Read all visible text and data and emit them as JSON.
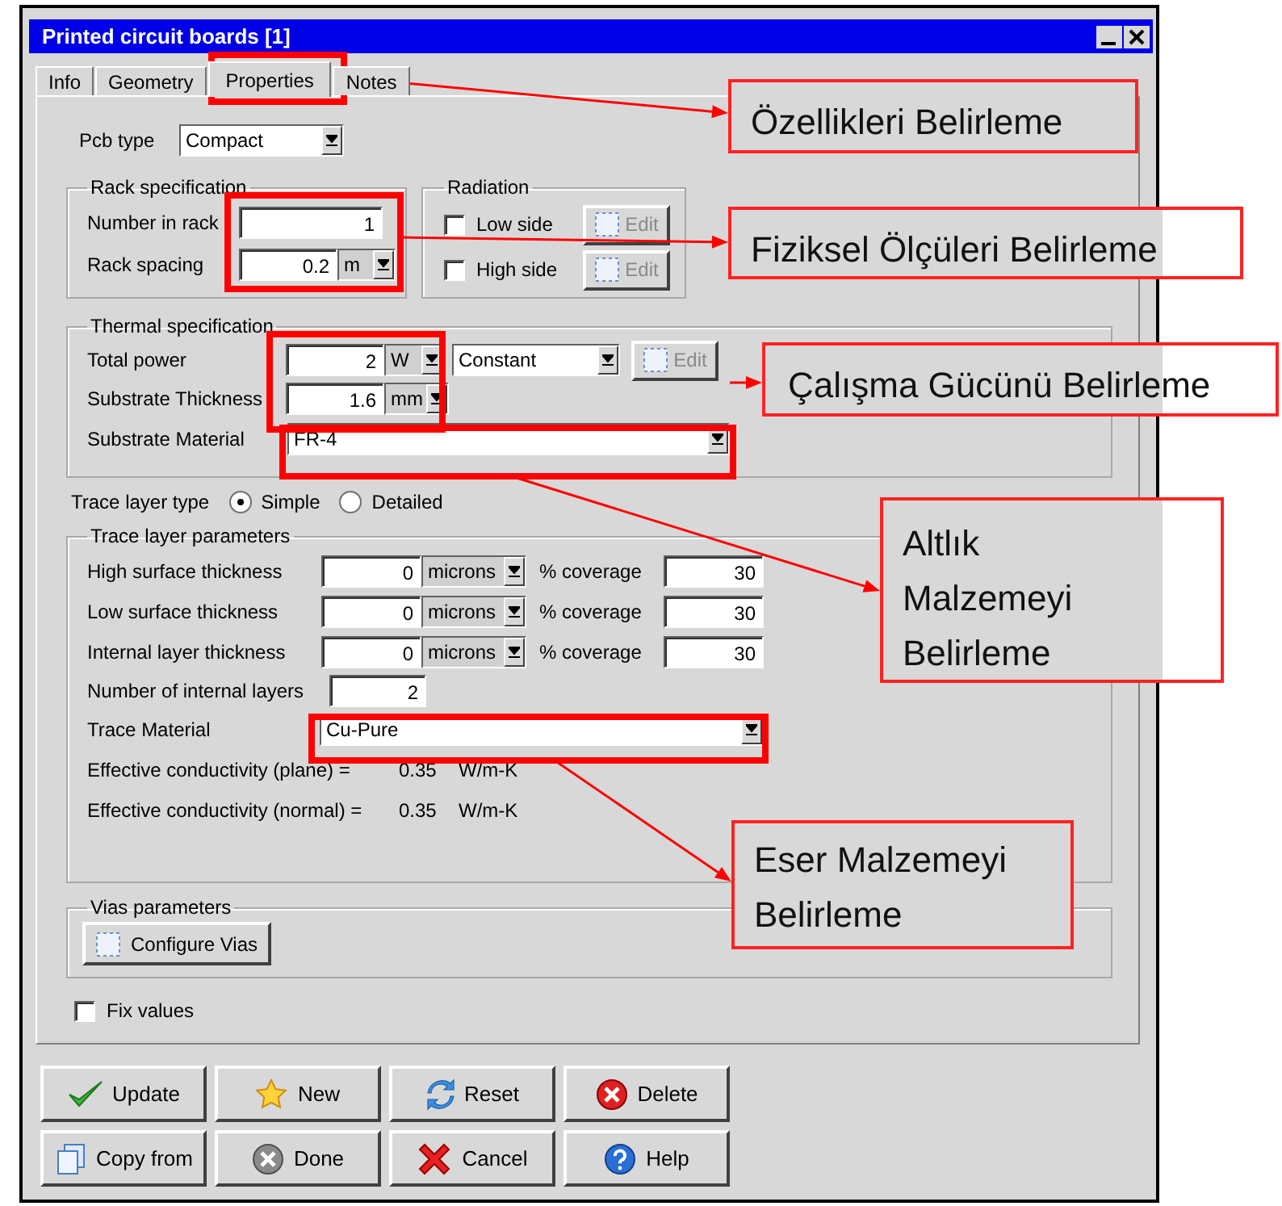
{
  "window": {
    "title": "Printed circuit boards [1]"
  },
  "tabs": [
    {
      "label": "Info",
      "selected": false
    },
    {
      "label": "Geometry",
      "selected": false
    },
    {
      "label": "Properties",
      "selected": true
    },
    {
      "label": "Notes",
      "selected": false
    }
  ],
  "pcb_type": {
    "label": "Pcb type",
    "value": "Compact"
  },
  "rack": {
    "title": "Rack specification",
    "number_label": "Number in rack",
    "number": "1",
    "spacing_label": "Rack spacing",
    "spacing": "0.2",
    "spacing_unit": "m"
  },
  "radiation": {
    "title": "Radiation",
    "sides": [
      {
        "label": "Low side",
        "checked": false,
        "button": "Edit",
        "disabled": true
      },
      {
        "label": "High side",
        "checked": false,
        "button": "Edit",
        "disabled": true
      }
    ]
  },
  "thermal": {
    "title": "Thermal specification",
    "power_label": "Total power",
    "power": "2",
    "power_unit": "W",
    "power_mode": "Constant",
    "edit": {
      "label": "Edit",
      "disabled": true
    },
    "thickness_label": "Substrate Thickness",
    "thickness": "1.6",
    "thickness_unit": "mm",
    "material_label": "Substrate Material",
    "material": "FR-4"
  },
  "trace_layer_type": {
    "label": "Trace layer type",
    "options": [
      {
        "label": "Simple",
        "selected": true
      },
      {
        "label": "Detailed",
        "selected": false
      }
    ]
  },
  "trace": {
    "title": "Trace layer parameters",
    "rows": [
      {
        "label": "High surface thickness",
        "value": "0",
        "unit": "microns",
        "coverage_label": "% coverage",
        "coverage": "30"
      },
      {
        "label": "Low surface thickness",
        "value": "0",
        "unit": "microns",
        "coverage_label": "% coverage",
        "coverage": "30"
      },
      {
        "label": "Internal layer thickness",
        "value": "0",
        "unit": "microns",
        "coverage_label": "% coverage",
        "coverage": "30"
      }
    ],
    "layers_label": "Number of internal layers",
    "layers": "2",
    "material_label": "Trace Material",
    "material": "Cu-Pure",
    "conductivity": [
      {
        "label": "Effective conductivity (plane) =",
        "value": "0.35",
        "unit": "W/m-K"
      },
      {
        "label": "Effective conductivity (normal) =",
        "value": "0.35",
        "unit": "W/m-K"
      }
    ]
  },
  "vias": {
    "title": "Vias parameters",
    "button": "Configure Vias"
  },
  "fix_values": {
    "label": "Fix values",
    "checked": false
  },
  "buttons": [
    {
      "label": "Update",
      "kind": "check"
    },
    {
      "label": "New",
      "kind": "star"
    },
    {
      "label": "Reset",
      "kind": "refresh"
    },
    {
      "label": "Delete",
      "kind": "delete"
    },
    {
      "label": "Copy from",
      "kind": "copy"
    },
    {
      "label": "Done",
      "kind": "done"
    },
    {
      "label": "Cancel",
      "kind": "cancel"
    },
    {
      "label": "Help",
      "kind": "help"
    }
  ],
  "annotations": [
    {
      "text": "Özellikleri Belirleme"
    },
    {
      "text": "Fiziksel Ölçüleri Belirleme"
    },
    {
      "text": "Çalışma Gücünü Belirleme"
    },
    {
      "text": "Altlık Malzemeyi Belirleme"
    },
    {
      "text": "Eser Malzemeyi Belirleme"
    }
  ]
}
